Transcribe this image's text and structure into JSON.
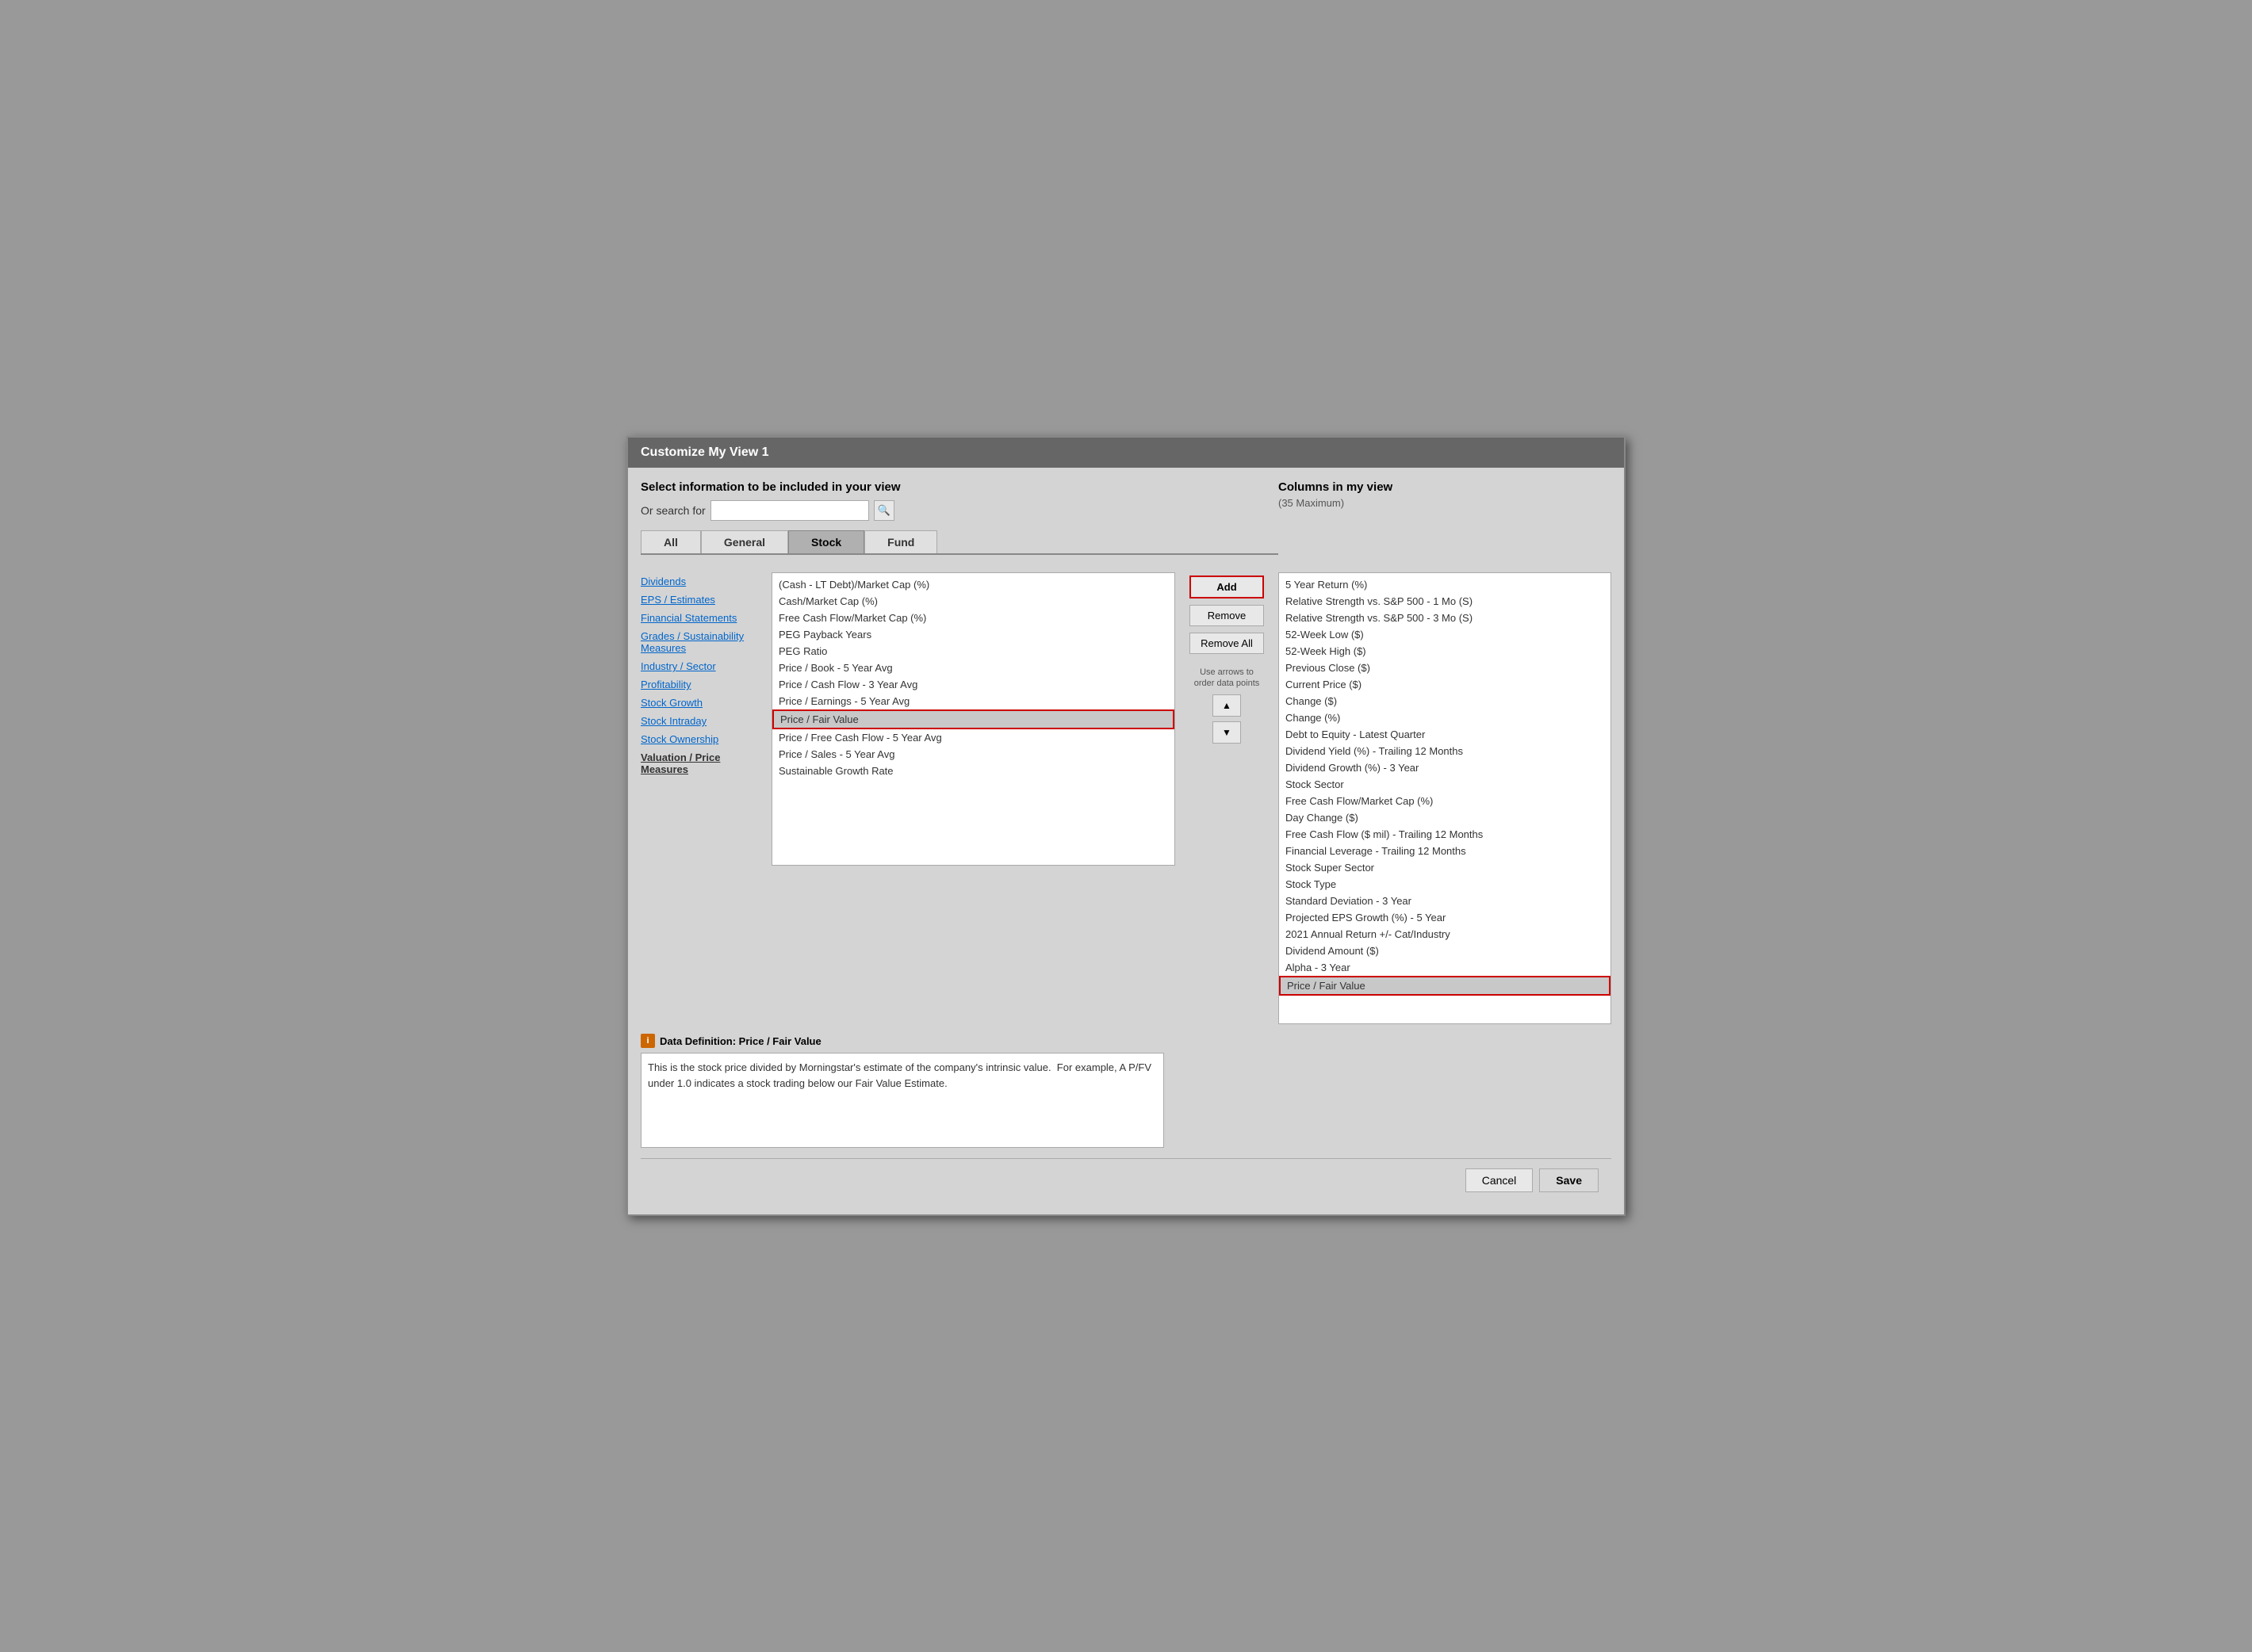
{
  "dialog": {
    "title": "Customize My View 1",
    "select_section_header": "Select information to be included in your view",
    "search_label": "Or search for",
    "search_placeholder": "",
    "columns_header": "Columns in my view",
    "columns_max": "(35 Maximum)"
  },
  "tabs": [
    {
      "label": "All",
      "active": false
    },
    {
      "label": "General",
      "active": false
    },
    {
      "label": "Stock",
      "active": true
    },
    {
      "label": "Fund",
      "active": false
    }
  ],
  "categories": [
    {
      "label": "Dividends",
      "bold": false
    },
    {
      "label": "EPS / Estimates",
      "bold": false
    },
    {
      "label": "Financial Statements",
      "bold": false
    },
    {
      "label": "Grades / Sustainability Measures",
      "bold": false
    },
    {
      "label": "Industry / Sector",
      "bold": false
    },
    {
      "label": "Profitability",
      "bold": false
    },
    {
      "label": "Stock Growth",
      "bold": false
    },
    {
      "label": "Stock Intraday",
      "bold": false
    },
    {
      "label": "Stock Ownership",
      "bold": false
    },
    {
      "label": "Valuation / Price Measures",
      "bold": true
    }
  ],
  "list_items": [
    {
      "label": "(Cash - LT Debt)/Market Cap (%)",
      "selected": false
    },
    {
      "label": "Cash/Market Cap (%)",
      "selected": false
    },
    {
      "label": "Free Cash Flow/Market Cap (%)",
      "selected": false
    },
    {
      "label": "PEG Payback Years",
      "selected": false
    },
    {
      "label": "PEG Ratio",
      "selected": false
    },
    {
      "label": "Price / Book - 5 Year Avg",
      "selected": false
    },
    {
      "label": "Price / Cash Flow - 3 Year Avg",
      "selected": false
    },
    {
      "label": "Price / Earnings - 5 Year Avg",
      "selected": false
    },
    {
      "label": "Price / Fair Value",
      "selected": true
    },
    {
      "label": "Price / Free Cash Flow - 5 Year Avg",
      "selected": false
    },
    {
      "label": "Price / Sales - 5 Year Avg",
      "selected": false
    },
    {
      "label": "Sustainable Growth Rate",
      "selected": false
    }
  ],
  "buttons": {
    "add": "Add",
    "remove": "Remove",
    "remove_all": "Remove All",
    "arrows_label": "Use arrows to order data points",
    "up_arrow": "▲",
    "down_arrow": "▼",
    "cancel": "Cancel",
    "save": "Save"
  },
  "columns_list": [
    {
      "label": "5 Year Return (%)",
      "selected": false
    },
    {
      "label": "Relative Strength vs. S&P 500 - 1 Mo (S)",
      "selected": false
    },
    {
      "label": "Relative Strength vs. S&P 500 - 3 Mo (S)",
      "selected": false
    },
    {
      "label": "52-Week Low ($)",
      "selected": false
    },
    {
      "label": "52-Week High ($)",
      "selected": false
    },
    {
      "label": "Previous Close ($)",
      "selected": false
    },
    {
      "label": "Current Price ($)",
      "selected": false
    },
    {
      "label": "Change ($)",
      "selected": false
    },
    {
      "label": "Change (%)",
      "selected": false
    },
    {
      "label": "Debt to Equity - Latest Quarter",
      "selected": false
    },
    {
      "label": "Dividend Yield (%) - Trailing 12 Months",
      "selected": false
    },
    {
      "label": "Dividend Growth (%) - 3 Year",
      "selected": false
    },
    {
      "label": "Stock Sector",
      "selected": false
    },
    {
      "label": "Free Cash Flow/Market Cap (%)",
      "selected": false
    },
    {
      "label": "Day Change ($)",
      "selected": false
    },
    {
      "label": "Free Cash Flow ($ mil) - Trailing 12 Months",
      "selected": false
    },
    {
      "label": "Financial Leverage - Trailing 12 Months",
      "selected": false
    },
    {
      "label": "Stock Super Sector",
      "selected": false
    },
    {
      "label": "Stock Type",
      "selected": false
    },
    {
      "label": "Standard Deviation - 3 Year",
      "selected": false
    },
    {
      "label": "Projected EPS Growth (%) - 5 Year",
      "selected": false
    },
    {
      "label": "2021 Annual Return +/- Cat/Industry",
      "selected": false
    },
    {
      "label": "Dividend Amount ($)",
      "selected": false
    },
    {
      "label": "Alpha - 3 Year",
      "selected": false
    },
    {
      "label": "Price / Fair Value",
      "selected": true
    }
  ],
  "data_definition": {
    "title": "Data Definition:  Price / Fair Value",
    "icon_label": "i",
    "text": "This is the stock price divided by Morningstar's estimate of the company's intrinsic value.  For example, A P/FV under 1.0 indicates a stock trading below our Fair Value Estimate."
  }
}
